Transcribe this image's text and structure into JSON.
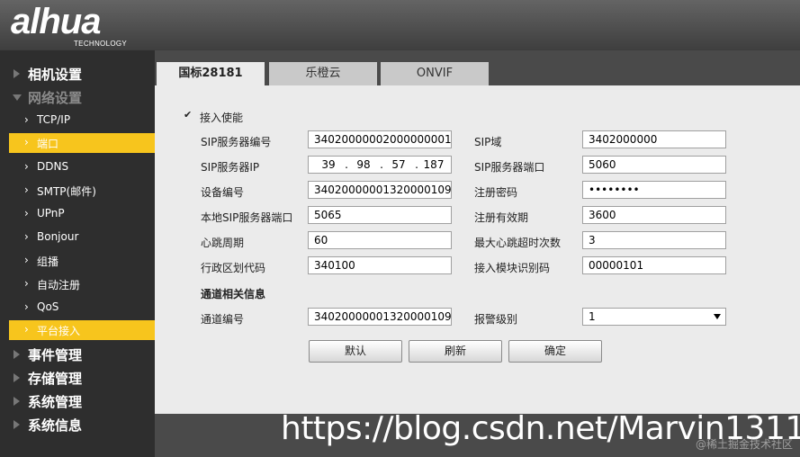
{
  "brand": {
    "logo": "alhua",
    "sub": "TECHNOLOGY"
  },
  "sidebar": {
    "items": [
      {
        "label": "相机设置",
        "type": "top",
        "state": "collapsed"
      },
      {
        "label": "网络设置",
        "type": "top",
        "state": "open"
      },
      {
        "label": "TCP/IP",
        "type": "sub"
      },
      {
        "label": "端口",
        "type": "sub",
        "active": true
      },
      {
        "label": "DDNS",
        "type": "sub"
      },
      {
        "label": "SMTP(邮件)",
        "type": "sub"
      },
      {
        "label": "UPnP",
        "type": "sub"
      },
      {
        "label": "Bonjour",
        "type": "sub"
      },
      {
        "label": "组播",
        "type": "sub"
      },
      {
        "label": "自动注册",
        "type": "sub"
      },
      {
        "label": "QoS",
        "type": "sub"
      },
      {
        "label": "平台接入",
        "type": "sub",
        "active": true
      },
      {
        "label": "事件管理",
        "type": "top",
        "state": "collapsed"
      },
      {
        "label": "存储管理",
        "type": "top",
        "state": "collapsed"
      },
      {
        "label": "系统管理",
        "type": "top",
        "state": "collapsed"
      },
      {
        "label": "系统信息",
        "type": "top",
        "state": "collapsed"
      }
    ]
  },
  "tabs": [
    {
      "label": "国标28181",
      "active": true
    },
    {
      "label": "乐橙云",
      "active": false
    },
    {
      "label": "ONVIF",
      "active": false
    }
  ],
  "form": {
    "enable": {
      "label": "接入使能",
      "checked": true,
      "mark": "✔"
    },
    "sip_server_id": {
      "label": "SIP服务器编号",
      "value": "34020000002000000001"
    },
    "sip_domain": {
      "label": "SIP域",
      "value": "3402000000"
    },
    "sip_server_ip": {
      "label": "SIP服务器IP",
      "parts": [
        "39",
        "98",
        "57",
        "187"
      ],
      "sep": "."
    },
    "sip_server_port": {
      "label": "SIP服务器端口",
      "value": "5060"
    },
    "device_id": {
      "label": "设备编号",
      "value": "34020000001320000109"
    },
    "reg_password": {
      "label": "注册密码",
      "value": "••••••••"
    },
    "local_sip_port": {
      "label": "本地SIP服务器端口",
      "value": "5065"
    },
    "reg_validity": {
      "label": "注册有效期",
      "value": "3600"
    },
    "heartbeat": {
      "label": "心跳周期",
      "value": "60"
    },
    "max_heartbeat_timeout": {
      "label": "最大心跳超时次数",
      "value": "3"
    },
    "region_code": {
      "label": "行政区划代码",
      "value": "340100"
    },
    "module_id": {
      "label": "接入模块识别码",
      "value": "00000101"
    },
    "channel_section": "通道相关信息",
    "channel_id": {
      "label": "通道编号",
      "value": "34020000001320000109"
    },
    "alarm_level": {
      "label": "报警级别",
      "value": "1"
    }
  },
  "buttons": {
    "default": "默认",
    "refresh": "刷新",
    "ok": "确定"
  },
  "watermark": {
    "url": "https://blog.csdn.net/Marvin1311",
    "corner": "@稀土掘金技术社区"
  },
  "colors": {
    "active": "#f7c51d",
    "sidebar": "#2e2e2e",
    "content": "#ebebeb"
  }
}
